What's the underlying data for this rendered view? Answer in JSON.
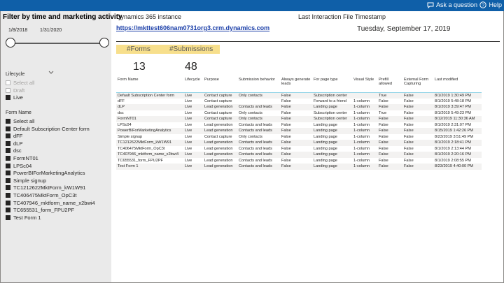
{
  "topbar": {
    "ask_label": "Ask a question",
    "help_label": "Help"
  },
  "filters": {
    "title": "Filter by time and marketing activity",
    "date_start": "1/8/2018",
    "date_end": "1/31/2020",
    "lifecycle": {
      "label": "Lifecycle",
      "items": [
        {
          "label": "Select all",
          "checked": false,
          "dim": true
        },
        {
          "label": "Draft",
          "checked": false,
          "dim": true
        },
        {
          "label": "Live",
          "checked": true,
          "dim": false
        }
      ]
    },
    "form_name": {
      "label": "Form Name",
      "items": [
        "Select all",
        "Default Subscription Center form",
        "dFF",
        "dLP",
        "dsc",
        "FormNT01",
        "LPSc04",
        "PowerBIForMarketingAnalytics",
        "Simple signup",
        "TC1212622MktForm_kW1W91",
        "TC406475MktForm_OpC3t",
        "TC407946_mktform_name_x2bwi4",
        "TC655531_form_FPU2PF",
        "Test Form 1"
      ]
    }
  },
  "instance": {
    "label": "Dynamics 365 instance",
    "url": "https://mkttest606nam0731org3.crm.dynamics.com"
  },
  "timestamp": {
    "label": "Last Interaction File Timestamp",
    "value": "Tuesday, September 17, 2019"
  },
  "kpis": {
    "forms_label": "#Forms",
    "forms_value": "13",
    "submissions_label": "#Submissions",
    "submissions_value": "48"
  },
  "table": {
    "columns": [
      "Form Name",
      "Lifecycle",
      "Purpose",
      "Submission behavior",
      "Always generate leads",
      "For page type",
      "Visual Style",
      "Prefill allowed",
      "External Form Capturing",
      "Last modified"
    ],
    "rows": [
      [
        "Default Subscription Center form",
        "Live",
        "Contact capture",
        "Only contacts",
        "False",
        "Subscription center",
        "",
        "True",
        "False",
        "8/1/2019 1:30:49 PM"
      ],
      [
        "dFF",
        "Live",
        "Contact capture",
        "",
        "False",
        "Forward to a friend",
        "1-column",
        "False",
        "False",
        "8/1/2019 5:48:18 PM"
      ],
      [
        "dLP",
        "Live",
        "Lead generation",
        "Contacts and leads",
        "False",
        "Landing page",
        "1-column",
        "False",
        "False",
        "8/1/2019 3:39:47 PM"
      ],
      [
        "dsc",
        "Live",
        "Contact capture",
        "Only contacts",
        "False",
        "Subscription center",
        "1-column",
        "True",
        "False",
        "8/1/2019 5:49:23 PM"
      ],
      [
        "FormNT01",
        "Live",
        "Contact capture",
        "Only contacts",
        "False",
        "Subscription center",
        "1-column",
        "False",
        "False",
        "8/12/2019 11:30:36 AM"
      ],
      [
        "LPSc04",
        "Live",
        "Lead generation",
        "Contacts and leads",
        "False",
        "Landing page",
        "1-column",
        "False",
        "False",
        "8/1/2019 2:31:07 PM"
      ],
      [
        "PowerBIForMarketingAnalytics",
        "Live",
        "Lead generation",
        "Contacts and leads",
        "False",
        "Landing page",
        "1-column",
        "False",
        "False",
        "8/15/2019 1:42:26 PM"
      ],
      [
        "Simple signup",
        "Live",
        "Contact capture",
        "Only contacts",
        "False",
        "Landing page",
        "1-column",
        "False",
        "False",
        "8/23/2019 3:51:49 PM"
      ],
      [
        "TC1212622MktForm_kW1W91",
        "Live",
        "Lead generation",
        "Contacts and leads",
        "False",
        "Landing page",
        "1-column",
        "False",
        "False",
        "8/1/2019 2:18:41 PM"
      ],
      [
        "TC406475MktForm_OpC3t",
        "Live",
        "Lead generation",
        "Contacts and leads",
        "False",
        "Landing page",
        "1-column",
        "False",
        "False",
        "8/1/2019 2:13:44 PM"
      ],
      [
        "TC407946_mktform_name_x2bwi4",
        "Live",
        "Lead generation",
        "Contacts and leads",
        "False",
        "Landing page",
        "1-column",
        "False",
        "False",
        "8/1/2019 2:20:16 PM"
      ],
      [
        "TC655531_form_FPU2PF",
        "Live",
        "Lead generation",
        "Contacts and leads",
        "False",
        "Landing page",
        "1-column",
        "False",
        "False",
        "8/1/2019 2:08:55 PM"
      ],
      [
        "Test Form 1",
        "Live",
        "Lead generation",
        "Contacts and leads",
        "False",
        "Landing page",
        "1-column",
        "False",
        "False",
        "8/23/2019 4:40:00 PM"
      ]
    ]
  }
}
